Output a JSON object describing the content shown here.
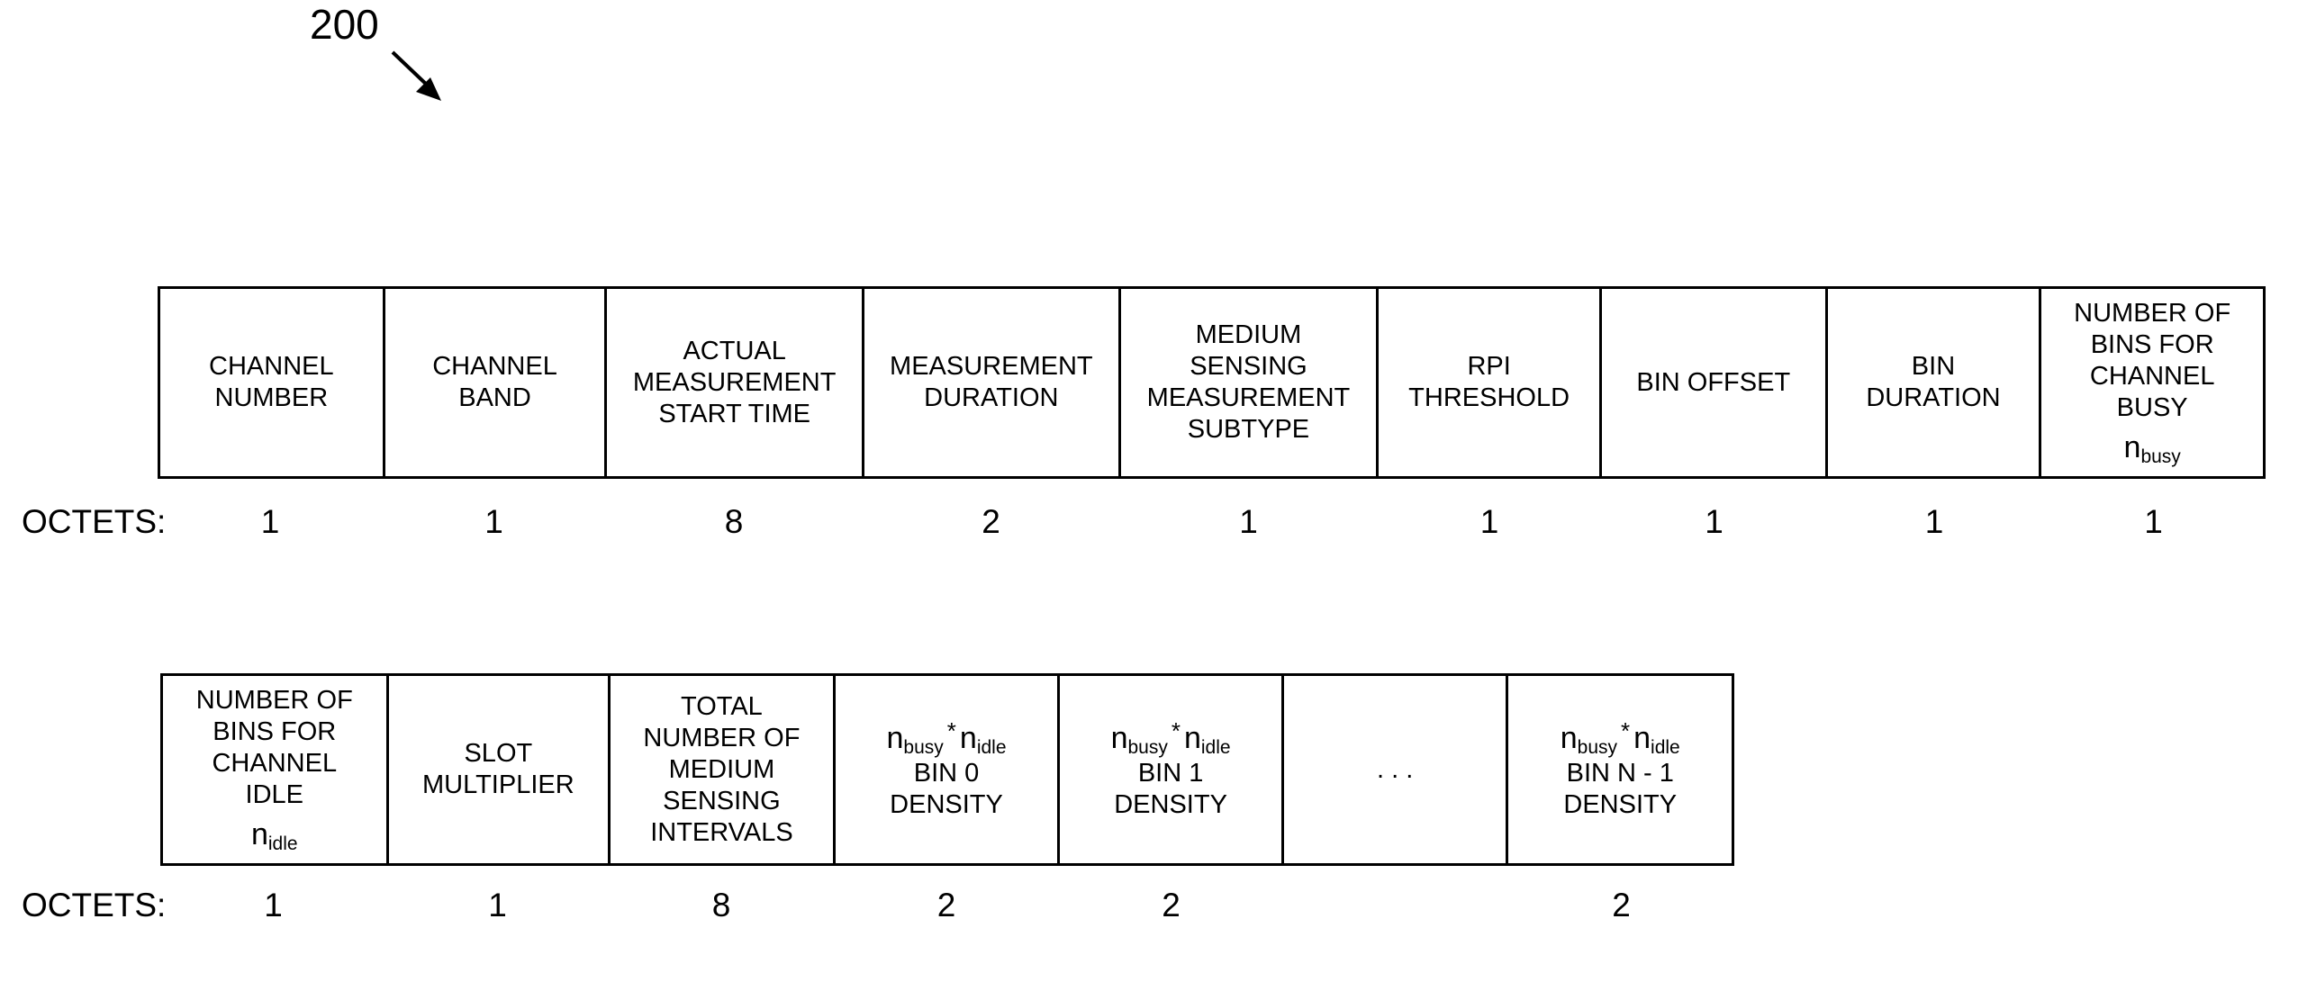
{
  "figure": {
    "reference_numeral": "200",
    "arrow_icon": "arrow-down-right-icon"
  },
  "rows": [
    {
      "fields": [
        {
          "lines": [
            "CHANNEL",
            "NUMBER"
          ],
          "symbol": null,
          "octets": "1"
        },
        {
          "lines": [
            "CHANNEL",
            "BAND"
          ],
          "symbol": null,
          "octets": "1"
        },
        {
          "lines": [
            "ACTUAL",
            "MEASUREMENT",
            "START TIME"
          ],
          "symbol": null,
          "octets": "8"
        },
        {
          "lines": [
            "MEASUREMENT",
            "DURATION"
          ],
          "symbol": null,
          "octets": "2"
        },
        {
          "lines": [
            "MEDIUM",
            "SENSING",
            "MEASUREMENT",
            "SUBTYPE"
          ],
          "symbol": null,
          "octets": "1"
        },
        {
          "lines": [
            "RPI",
            "THRESHOLD"
          ],
          "symbol": null,
          "octets": "1"
        },
        {
          "lines": [
            "BIN OFFSET"
          ],
          "symbol": null,
          "octets": "1"
        },
        {
          "lines": [
            "BIN",
            "DURATION"
          ],
          "symbol": null,
          "octets": "1"
        },
        {
          "lines": [
            "NUMBER OF",
            "BINS FOR",
            "CHANNEL",
            "BUSY"
          ],
          "symbol": {
            "base": "n",
            "sub": "busy"
          },
          "octets": "1"
        }
      ]
    },
    {
      "fields": [
        {
          "lines": [
            "NUMBER OF",
            "BINS FOR",
            "CHANNEL",
            "IDLE"
          ],
          "symbol": {
            "base": "n",
            "sub": "idle"
          },
          "octets": "1"
        },
        {
          "lines": [
            "SLOT",
            "MULTIPLIER"
          ],
          "symbol": null,
          "octets": "1"
        },
        {
          "lines": [
            "TOTAL",
            "NUMBER OF",
            "MEDIUM",
            "SENSING",
            "INTERVALS"
          ],
          "symbol": null,
          "octets": "8"
        },
        {
          "product": {
            "a": "n",
            "a_sub": "busy",
            "op": "*",
            "b": "n",
            "b_sub": "idle"
          },
          "lines": [
            "BIN 0",
            "DENSITY"
          ],
          "octets": "2"
        },
        {
          "product": {
            "a": "n",
            "a_sub": "busy",
            "op": "*",
            "b": "n",
            "b_sub": "idle"
          },
          "lines": [
            "BIN 1",
            "DENSITY"
          ],
          "octets": "2"
        },
        {
          "lines": [
            ". . ."
          ],
          "symbol": null,
          "octets": ""
        },
        {
          "product": {
            "a": "n",
            "a_sub": "busy",
            "op": "*",
            "b": "n",
            "b_sub": "idle"
          },
          "lines": [
            "BIN N - 1",
            "DENSITY"
          ],
          "octets": "2"
        }
      ]
    }
  ],
  "octets_label": "OCTETS:"
}
